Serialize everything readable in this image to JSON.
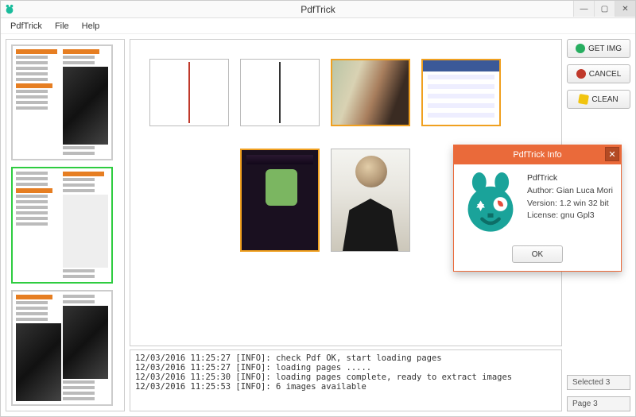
{
  "window": {
    "title": "PdfTrick",
    "minimize": "—",
    "maximize": "▢",
    "close": "✕"
  },
  "menu": {
    "items": [
      "PdfTrick",
      "File",
      "Help"
    ]
  },
  "buttons": {
    "get_img": "GET IMG",
    "cancel": "CANCEL",
    "clean": "CLEAN"
  },
  "status": {
    "selected_label": "Selected 3",
    "page_label": "Page 3"
  },
  "log_lines": [
    "12/03/2016 11:25:27 [INFO]: check Pdf OK, start loading pages",
    "12/03/2016 11:25:27 [INFO]: loading pages .....",
    "12/03/2016 11:25:30 [INFO]: loading pages complete, ready to extract images",
    "12/03/2016 11:25:53 [INFO]: 6 images available"
  ],
  "dialog": {
    "title": "PdfTrick Info",
    "app": "PdfTrick",
    "author": "Author: Gian Luca Mori",
    "version": "Version: 1.2 win 32 bit",
    "license": "License: gnu Gpl3",
    "ok": "OK",
    "close": "✕"
  },
  "thumbnails": {
    "count": 3,
    "selected_index": 1
  },
  "images": {
    "total": 6,
    "selected_indices": [
      2,
      3,
      4
    ]
  },
  "colors": {
    "accent_orange": "#ea6a3a",
    "select_green": "#2ecc40",
    "select_amber": "#f0a020"
  }
}
